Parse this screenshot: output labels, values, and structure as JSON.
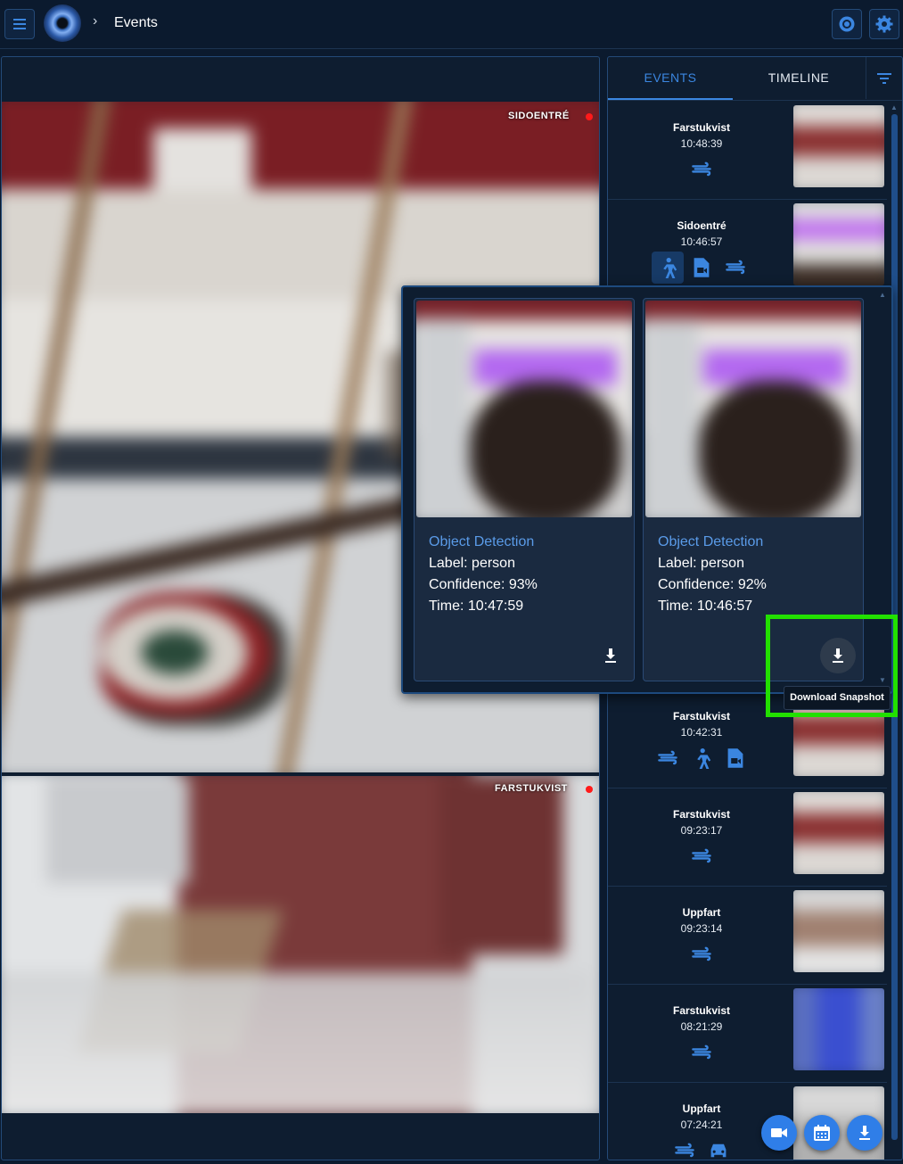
{
  "header": {
    "breadcrumb": "Events",
    "menu_icon": "menu-icon",
    "theme_icon": "brightness-icon",
    "settings_icon": "gear-icon"
  },
  "cameras": [
    {
      "label": "SIDOENTRÉ",
      "status_color": "#ff1a1a"
    },
    {
      "label": "FARSTUKVIST",
      "status_color": "#ff1a1a"
    }
  ],
  "tabs": {
    "events": "EVENTS",
    "timeline": "TIMELINE"
  },
  "events": [
    {
      "title": "Farstukvist",
      "time": "10:48:39",
      "icons": [
        "motion-icon"
      ]
    },
    {
      "title": "Sidoentré",
      "time": "10:46:57",
      "icons": [
        "person-icon",
        "video-file-icon",
        "motion-icon"
      ]
    },
    {
      "title": "Farstukvist",
      "time": "10:42:31",
      "icons": [
        "motion-icon",
        "person-icon",
        "video-file-icon"
      ]
    },
    {
      "title": "Farstukvist",
      "time": "09:23:17",
      "icons": [
        "motion-icon"
      ]
    },
    {
      "title": "Uppfart",
      "time": "09:23:14",
      "icons": [
        "motion-icon"
      ]
    },
    {
      "title": "Farstukvist",
      "time": "08:21:29",
      "icons": [
        "motion-icon"
      ]
    },
    {
      "title": "Uppfart",
      "time": "07:24:21",
      "icons": [
        "motion-icon",
        "car-icon"
      ]
    }
  ],
  "popup": {
    "cards": [
      {
        "title": "Object Detection",
        "label": "Label: person",
        "confidence": "Confidence: 93%",
        "time": "Time: 10:47:59"
      },
      {
        "title": "Object Detection",
        "label": "Label: person",
        "confidence": "Confidence: 92%",
        "time": "Time: 10:46:57"
      }
    ],
    "tooltip": "Download Snapshot"
  },
  "fabs": [
    "video-camera-icon",
    "calendar-icon",
    "download-icon"
  ],
  "colors": {
    "accent": "#3b86e0",
    "background": "#0b1a2e",
    "highlight": "#22e000",
    "record": "#ff1a1a"
  }
}
